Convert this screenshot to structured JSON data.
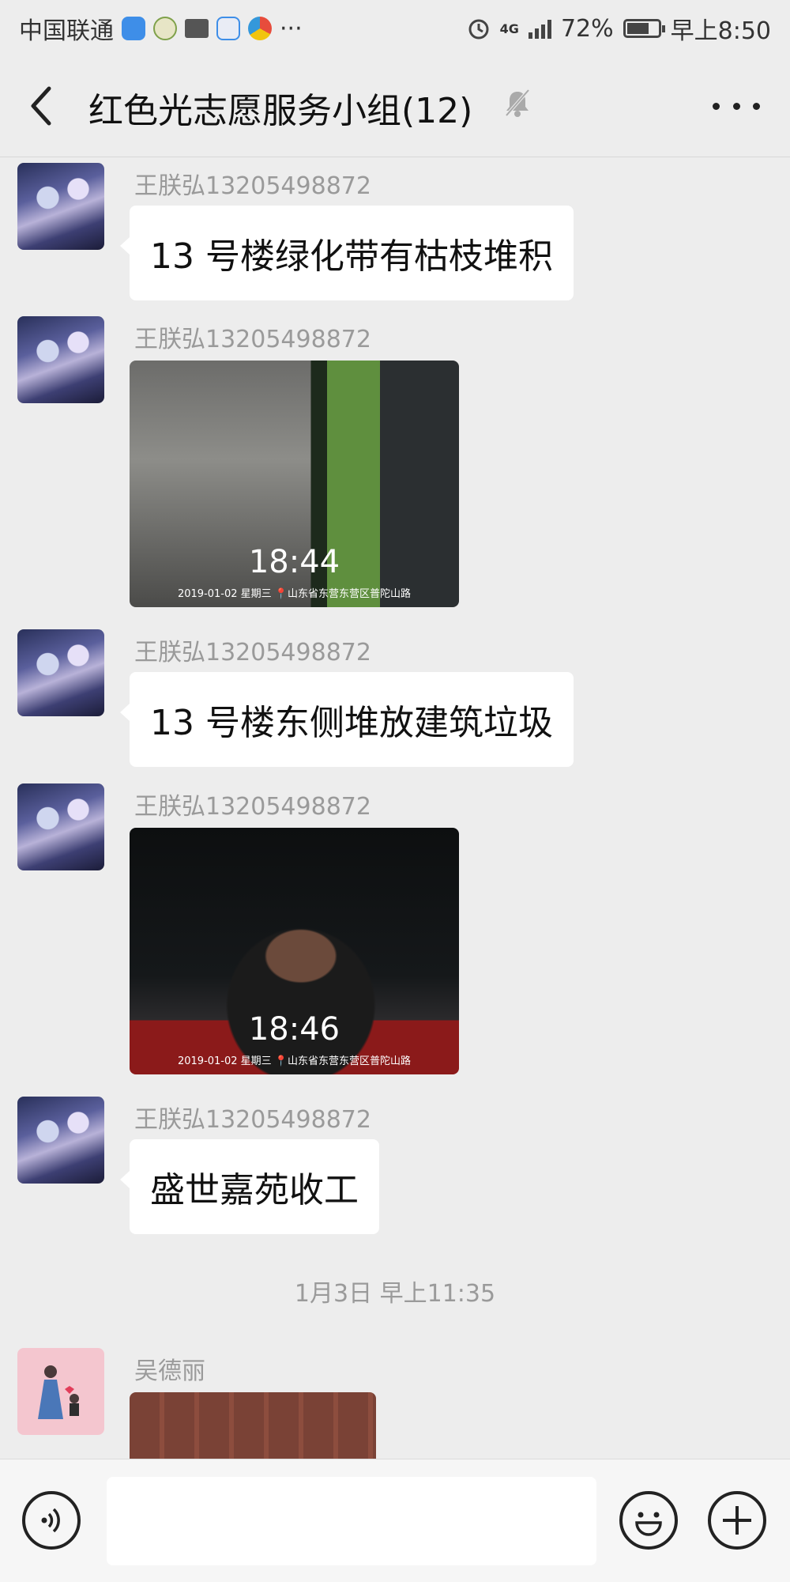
{
  "status_bar": {
    "carrier": "中国联通",
    "network": "4G",
    "battery_percent": "72%",
    "battery_level": 0.72,
    "time": "早上8:50",
    "overflow": "···"
  },
  "header": {
    "title": "红色光志愿服务小组(12)",
    "back_icon": "chevron-left-icon",
    "mute_icon": "bell-muted-icon",
    "more_icon": "more-dots-icon"
  },
  "messages": [
    {
      "sender": "王朕弘13205498872",
      "type": "text",
      "text": "13 号楼绿化带有枯枝堆积"
    },
    {
      "sender": "王朕弘13205498872",
      "type": "image",
      "overlay_time": "18:44",
      "overlay_caption": "2019-01-02 星期三 📍山东省东营东营区普陀山路"
    },
    {
      "sender": "王朕弘13205498872",
      "type": "text",
      "text": "13 号楼东侧堆放建筑垃圾"
    },
    {
      "sender": "王朕弘13205498872",
      "type": "image",
      "overlay_time": "18:46",
      "overlay_caption": "2019-01-02 星期三 📍山东省东营东营区普陀山路"
    },
    {
      "sender": "王朕弘13205498872",
      "type": "text",
      "text": "盛世嘉苑收工"
    },
    {
      "sender": "吴德丽",
      "type": "image"
    }
  ],
  "timestamp_divider": "1月3日 早上11:35",
  "input_bar": {
    "placeholder": "",
    "voice_icon": "voice-icon",
    "emoji_icon": "emoji-icon",
    "plus_icon": "plus-icon"
  }
}
